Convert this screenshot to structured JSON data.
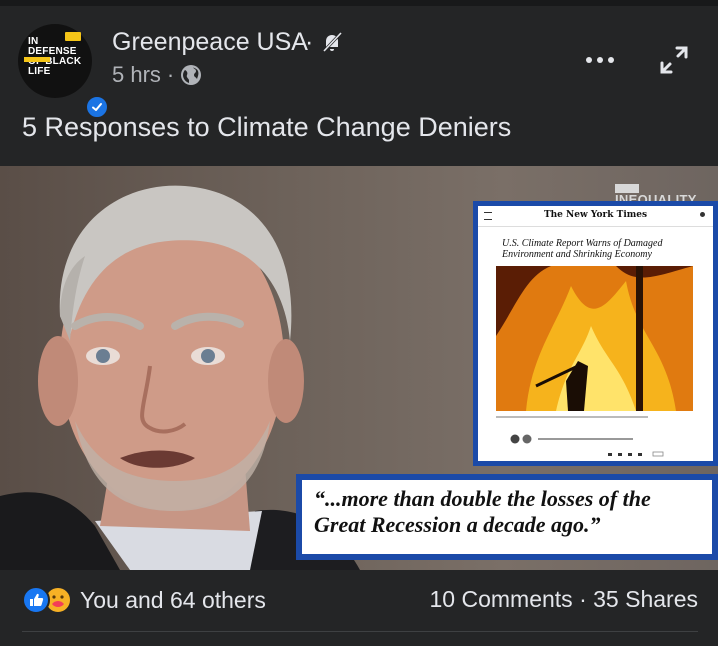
{
  "post": {
    "avatar_text": "IN DEFENSE OF BLACK LIFE",
    "page_name": "Greenpeace USA",
    "name_separator": "·",
    "time": "5 hrs",
    "time_separator": "·",
    "title": "5 Responses to Climate Change Deniers"
  },
  "media": {
    "watermark": "INEQUALITY MEDIA",
    "article": {
      "masthead": "The New York Times",
      "headline": "U.S. Climate Report Warns of Damaged Environment and Shrinking Economy"
    },
    "quote": "“...more than double the losses of the Great Recession a decade ago.”"
  },
  "footer": {
    "reactions_label": "You and 64 others",
    "comments": "10 Comments",
    "stats_separator": "·",
    "shares": "35 Shares"
  },
  "colors": {
    "background": "#242526",
    "text": "#e4e6eb",
    "secondary_text": "#b0b3b8",
    "like_blue": "#1877f2",
    "frame_blue": "#1b4aa8"
  },
  "icons": [
    "bell-off-icon",
    "globe-icon",
    "more-icon",
    "expand-icon",
    "verified-icon",
    "like-reaction-icon",
    "care-reaction-icon"
  ]
}
